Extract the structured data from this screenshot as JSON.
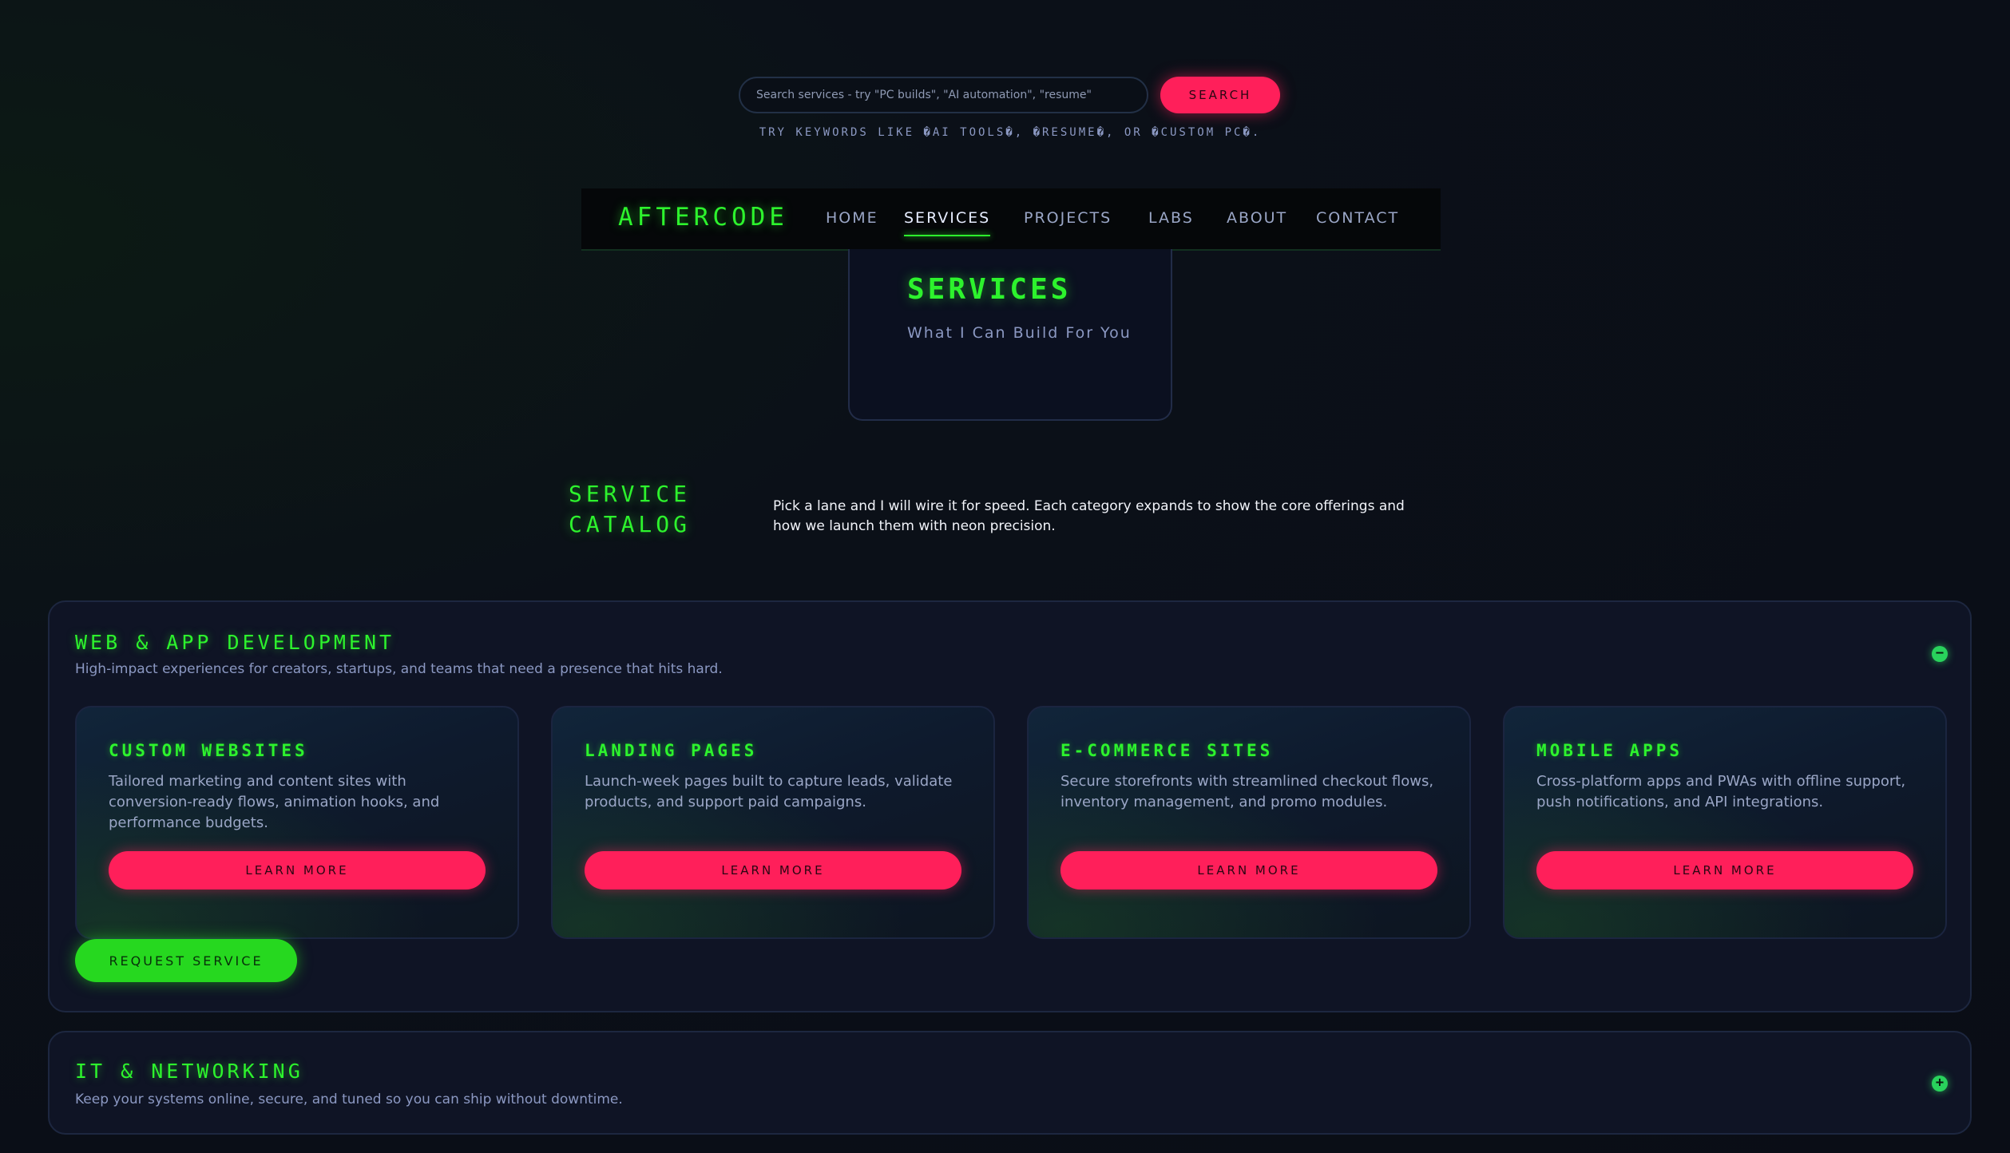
{
  "search": {
    "placeholder": "Search services - try \"PC builds\", \"AI automation\", \"resume\"",
    "button_label": "SEARCH",
    "hint": "TRY KEYWORDS LIKE �AI TOOLS�, �RESUME�, OR �CUSTOM PC�."
  },
  "nav": {
    "brand": "AFTERCODE",
    "links": [
      {
        "label": "HOME"
      },
      {
        "label": "SERVICES",
        "active": true
      },
      {
        "label": "PROJECTS"
      },
      {
        "label": "LABS"
      },
      {
        "label": "ABOUT"
      },
      {
        "label": "CONTACT"
      }
    ]
  },
  "hero": {
    "title": "SERVICES",
    "subtitle": "What I Can Build For You"
  },
  "catalog": {
    "title": "SERVICE CATALOG",
    "description": "Pick a lane and I will wire it for speed. Each category expands to show the core offerings and how we launch them with neon precision."
  },
  "categories": [
    {
      "title": "WEB & APP DEVELOPMENT",
      "subtitle": "High-impact experiences for creators, startups, and teams that need a presence that hits hard.",
      "expanded": true,
      "toggle_icon": "minus-icon",
      "cards": [
        {
          "title": "CUSTOM WEBSITES",
          "description": "Tailored marketing and content sites with conversion-ready flows, animation hooks, and performance budgets.",
          "button": "LEARN MORE"
        },
        {
          "title": "LANDING PAGES",
          "description": "Launch-week pages built to capture leads, validate products, and support paid campaigns.",
          "button": "LEARN MORE"
        },
        {
          "title": "E-COMMERCE SITES",
          "description": "Secure storefronts with streamlined checkout flows, inventory management, and promo modules.",
          "button": "LEARN MORE"
        },
        {
          "title": "MOBILE APPS",
          "description": "Cross-platform apps and PWAs with offline support, push notifications, and API integrations.",
          "button": "LEARN MORE"
        }
      ],
      "request_button": "REQUEST SERVICE"
    },
    {
      "title": "IT & NETWORKING",
      "subtitle": "Keep your systems online, secure, and tuned so you can ship without downtime.",
      "expanded": false,
      "toggle_icon": "plus-icon"
    }
  ],
  "colors": {
    "accent_green": "#2df32d",
    "accent_pink": "#ff1f5a",
    "background": "#0a0d16",
    "panel": "#0f1425"
  }
}
